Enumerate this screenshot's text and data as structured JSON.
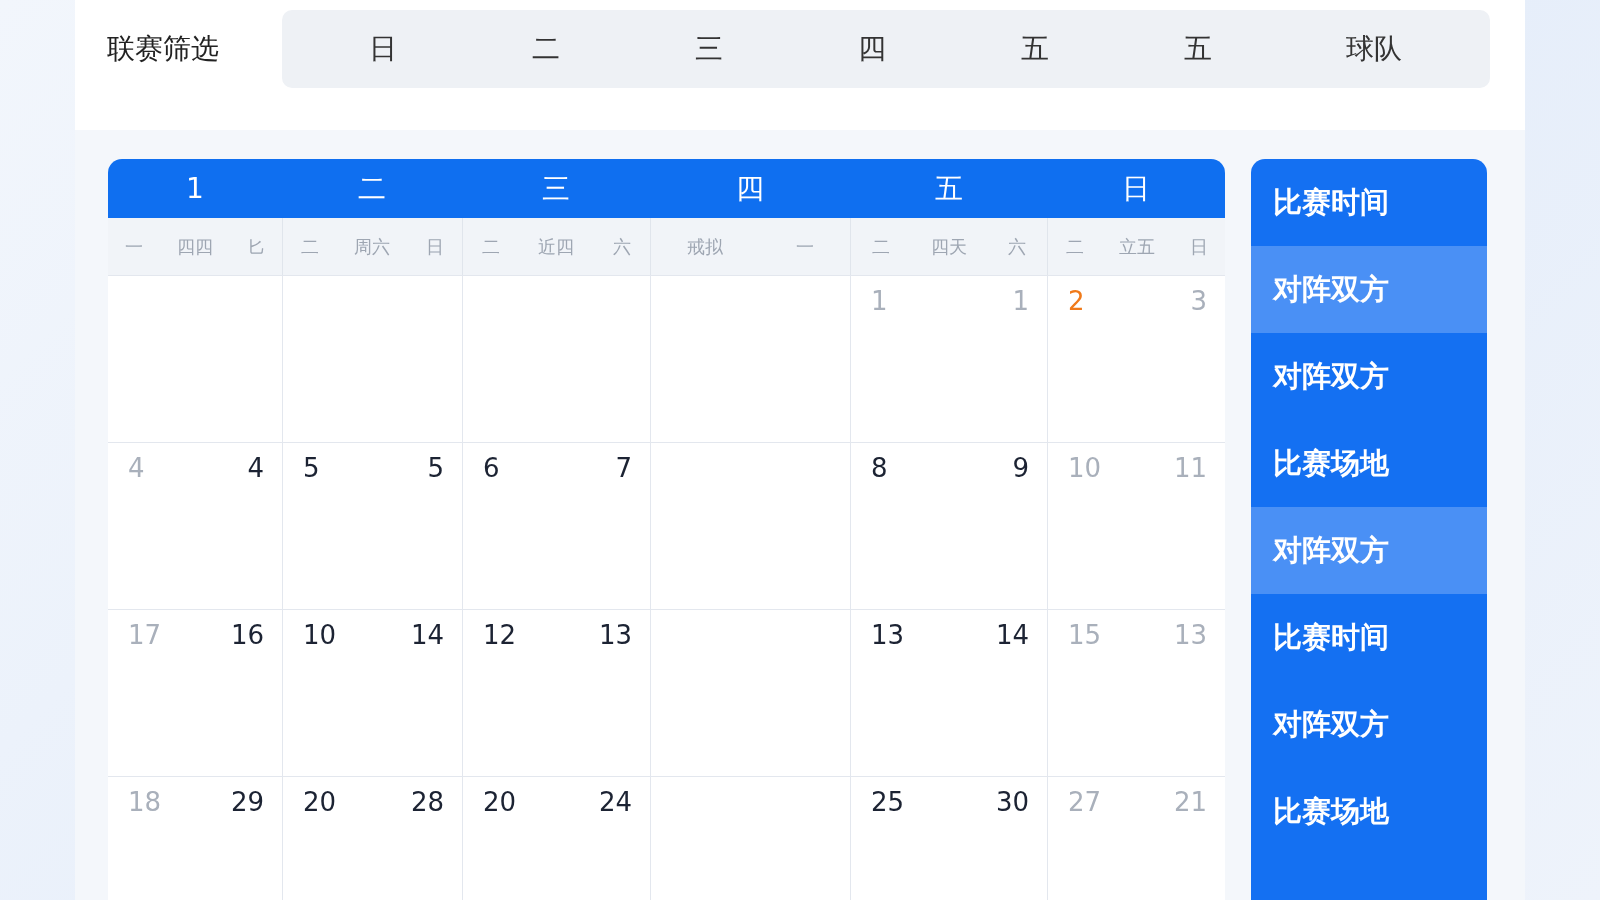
{
  "filter": {
    "label": "联赛筛选",
    "options": [
      "日",
      "二",
      "三",
      "四",
      "五",
      "五",
      "球队"
    ]
  },
  "calendar": {
    "columns": [
      {
        "title": "1",
        "sub": [
          "一",
          "四四",
          "匕"
        ]
      },
      {
        "title": "二",
        "sub": [
          "二",
          "周六",
          "日"
        ]
      },
      {
        "title": "三",
        "sub": [
          "二",
          "近四",
          "六"
        ]
      },
      {
        "title": "四",
        "sub": [
          "戒拟",
          "一"
        ]
      },
      {
        "title": "五",
        "sub": [
          "二",
          "四天",
          "六"
        ]
      },
      {
        "title": "日",
        "sub": [
          "二",
          "立五",
          "日"
        ]
      }
    ],
    "rows": [
      [
        [],
        [],
        [],
        [],
        [
          {
            "n": "1",
            "muted": true,
            "highlighted": false
          },
          {
            "n": "1",
            "muted": true,
            "highlighted": false
          }
        ],
        [
          {
            "n": "2",
            "muted": false,
            "highlighted": true
          },
          {
            "n": "3",
            "muted": true,
            "highlighted": false
          }
        ]
      ],
      [
        [
          {
            "n": "4",
            "muted": true,
            "highlighted": false
          },
          {
            "n": "4",
            "muted": false,
            "highlighted": false
          }
        ],
        [
          {
            "n": "5",
            "muted": false,
            "highlighted": false
          },
          {
            "n": "5",
            "muted": false,
            "highlighted": false
          }
        ],
        [
          {
            "n": "6",
            "muted": false,
            "highlighted": false
          },
          {
            "n": "7",
            "muted": false,
            "highlighted": false
          }
        ],
        [],
        [
          {
            "n": "8",
            "muted": false,
            "highlighted": false
          },
          {
            "n": "9",
            "muted": false,
            "highlighted": false
          }
        ],
        [
          {
            "n": "10",
            "muted": true,
            "highlighted": false
          },
          {
            "n": "11",
            "muted": true,
            "highlighted": false
          }
        ]
      ],
      [
        [
          {
            "n": "17",
            "muted": true,
            "highlighted": false
          },
          {
            "n": "16",
            "muted": false,
            "highlighted": false
          }
        ],
        [
          {
            "n": "10",
            "muted": false,
            "highlighted": false
          },
          {
            "n": "14",
            "muted": false,
            "highlighted": false
          }
        ],
        [
          {
            "n": "12",
            "muted": false,
            "highlighted": false
          },
          {
            "n": "13",
            "muted": false,
            "highlighted": false
          }
        ],
        [],
        [
          {
            "n": "13",
            "muted": false,
            "highlighted": false
          },
          {
            "n": "14",
            "muted": false,
            "highlighted": false
          }
        ],
        [
          {
            "n": "15",
            "muted": true,
            "highlighted": false
          },
          {
            "n": "13",
            "muted": true,
            "highlighted": false
          }
        ]
      ],
      [
        [
          {
            "n": "18",
            "muted": true,
            "highlighted": false
          },
          {
            "n": "29",
            "muted": false,
            "highlighted": false
          }
        ],
        [
          {
            "n": "20",
            "muted": false,
            "highlighted": false
          },
          {
            "n": "28",
            "muted": false,
            "highlighted": false
          }
        ],
        [
          {
            "n": "20",
            "muted": false,
            "highlighted": false
          },
          {
            "n": "24",
            "muted": false,
            "highlighted": false
          }
        ],
        [],
        [
          {
            "n": "25",
            "muted": false,
            "highlighted": false
          },
          {
            "n": "30",
            "muted": false,
            "highlighted": false
          }
        ],
        [
          {
            "n": "27",
            "muted": true,
            "highlighted": false
          },
          {
            "n": "21",
            "muted": true,
            "highlighted": false
          }
        ]
      ]
    ]
  },
  "sidebar": {
    "items": [
      {
        "label": "比赛时间",
        "selected": false
      },
      {
        "label": "对阵双方",
        "selected": true
      },
      {
        "label": "对阵双方",
        "selected": false
      },
      {
        "label": "比赛场地",
        "selected": false
      },
      {
        "label": "对阵双方",
        "selected": true
      },
      {
        "label": "比赛时间",
        "selected": false
      },
      {
        "label": "对阵双方",
        "selected": false
      },
      {
        "label": "比赛场地",
        "selected": false
      },
      {
        "selected": false
      }
    ]
  }
}
